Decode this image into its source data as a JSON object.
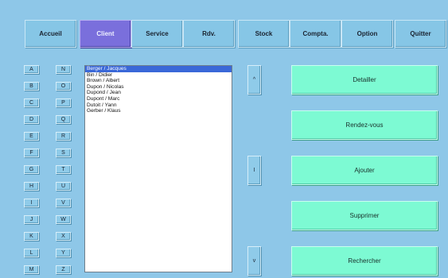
{
  "nav": [
    {
      "id": "accueil",
      "label": "Accueil"
    },
    {
      "id": "client",
      "label": "Client",
      "active": true
    },
    {
      "id": "service",
      "label": "Service"
    },
    {
      "id": "rdv",
      "label": "Rdv."
    },
    {
      "id": "stock",
      "label": "Stock"
    },
    {
      "id": "compta",
      "label": "Compta."
    },
    {
      "id": "option",
      "label": "Option"
    },
    {
      "id": "quitter",
      "label": "Quitter"
    }
  ],
  "alphabet": {
    "left": [
      "A",
      "B",
      "C",
      "D",
      "E",
      "F",
      "G",
      "H",
      "I",
      "J",
      "K",
      "L",
      "M"
    ],
    "right": [
      "N",
      "O",
      "P",
      "Q",
      "R",
      "S",
      "T",
      "U",
      "V",
      "W",
      "X",
      "Y",
      "Z"
    ]
  },
  "clients": [
    "Berger / Jacques",
    "Bin / Didier",
    "Brown / Albert",
    "Dupon / Nicolas",
    "Dupond / Jean",
    "Dupont / Marc",
    "Dutoit / Yann",
    "Gerber / Klaus"
  ],
  "selected_client_index": 0,
  "scroll": {
    "up": "^",
    "middle": "I",
    "down": "v"
  },
  "actions": [
    {
      "id": "detailler",
      "label": "Detailler"
    },
    {
      "id": "rendez-vous",
      "label": "Rendez-vous"
    },
    {
      "id": "ajouter",
      "label": "Ajouter"
    },
    {
      "id": "supprimer",
      "label": "Supprimer"
    },
    {
      "id": "rechercher",
      "label": "Rechercher"
    }
  ],
  "colors": {
    "background": "#8ec7e8",
    "active_nav": "#7a6fdc",
    "action_button": "#7dfad3",
    "selection": "#3a68d8"
  }
}
